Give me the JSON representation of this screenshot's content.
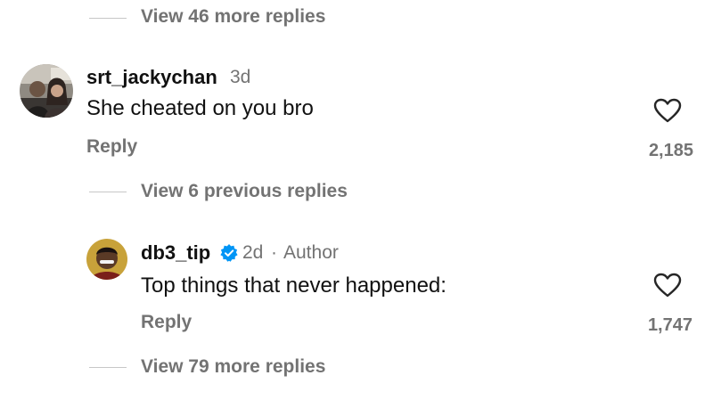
{
  "top_thread": {
    "view_more_label": "View 46 more replies"
  },
  "comment1": {
    "username": "srt_jackychan",
    "time": "3d",
    "text": "She cheated on you bro",
    "reply_label": "Reply",
    "like_count": "2,185",
    "like_icon": "heart-outline-icon"
  },
  "thread1": {
    "view_previous_label": "View 6 previous replies"
  },
  "comment2": {
    "username": "db3_tip",
    "verified_icon": "verified-badge-icon",
    "verified_color": "#0095f6",
    "time": "2d",
    "separator": "·",
    "author_label": "Author",
    "text": "Top things that never happened:",
    "reply_label": "Reply",
    "like_count": "1,747",
    "like_icon": "heart-outline-icon"
  },
  "thread2": {
    "view_more_label": "View 79 more replies"
  }
}
